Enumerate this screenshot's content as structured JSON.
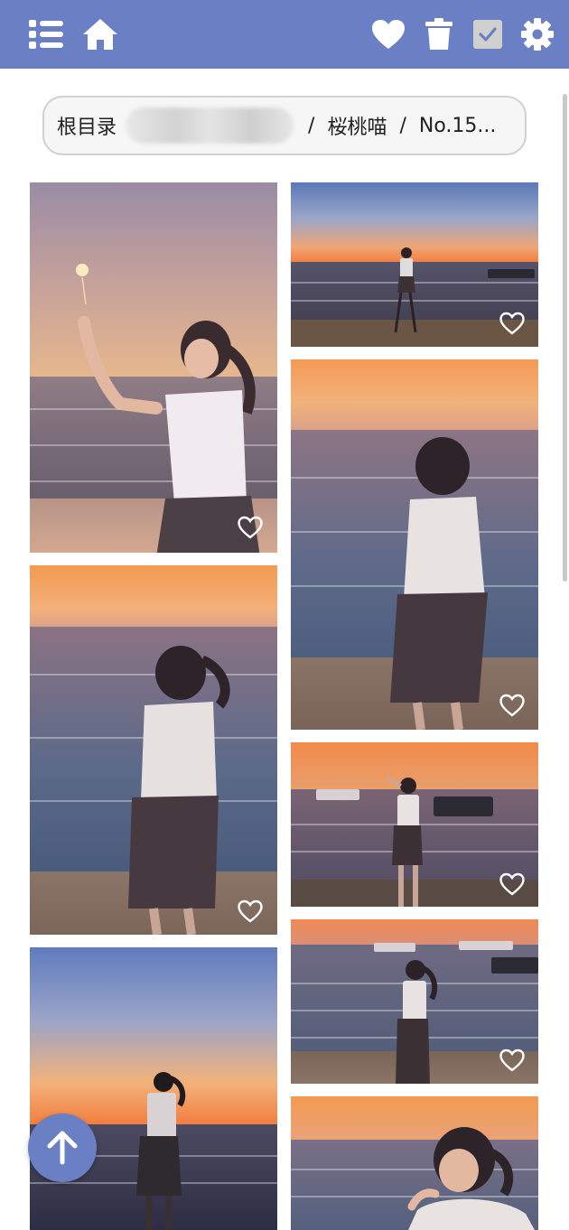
{
  "colors": {
    "accent": "#6b7fc4",
    "icon_white": "#ffffff",
    "checkbox_gray": "#d0d0d0"
  },
  "toolbar": {
    "icons": [
      "list-icon",
      "home-icon",
      "heart-icon",
      "trash-icon",
      "checkbox-icon",
      "gear-icon"
    ]
  },
  "breadcrumb": {
    "root": "根目录",
    "separator": "/",
    "folder": "桜桃喵",
    "album": "No.15..."
  },
  "photos": [
    {
      "name": "photo-sparkler",
      "favorited": false
    },
    {
      "name": "photo-beach-wide",
      "favorited": false
    },
    {
      "name": "photo-girl-back",
      "favorited": false
    },
    {
      "name": "photo-girl-side",
      "favorited": false
    },
    {
      "name": "photo-boat-salute",
      "favorited": false
    },
    {
      "name": "photo-boats-profile",
      "favorited": false
    },
    {
      "name": "photo-silhouette",
      "favorited": false
    },
    {
      "name": "photo-closeup",
      "favorited": false
    }
  ],
  "fab": {
    "icon": "arrow-up-icon"
  }
}
